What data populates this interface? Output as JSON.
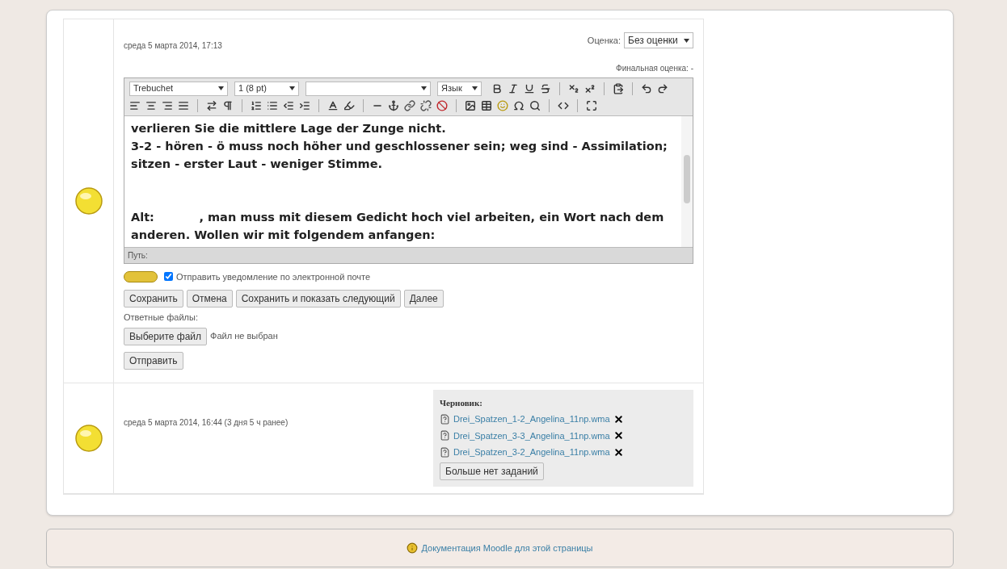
{
  "submissions": [
    {
      "kind": "editing",
      "date": "среда 5 марта 2014, 17:13",
      "grade_label": "Оценка:",
      "grade_value": "Без оценки",
      "final_grade": "Финальная оценка: -",
      "editor": {
        "font": "Trebuchet",
        "size": "1 (8 pt)",
        "language": "Язык",
        "paragraphs": [
          "verlieren Sie die mittlere Lage der Zunge nicht.\n3-2 - hören - ö muss noch höher und geschlossener sein; weg sind - Assimilation; sitzen - erster Laut - weniger Stimme.",
          "Alt:           , man muss mit diesem Gedicht hoch viel arbeiten, ein Wort nach dem anderen. Wollen wir mit folgendem anfangen:"
        ],
        "path_label": "Путь:"
      },
      "notify": {
        "label": "Отправить уведомление по электронной почте",
        "checked": true
      },
      "buttons": [
        "Сохранить",
        "Отмена",
        "Сохранить и показать следующий",
        "Далее"
      ],
      "files_label": "Ответные файлы:",
      "choose_button": "Выберите файл",
      "no_file": "Файл не выбран",
      "send_button": "Отправить"
    },
    {
      "kind": "draft",
      "date": "среда 5 марта 2014, 16:44 (3 дня 5 ч ранее)",
      "drafts_title": "Черновик:",
      "files": [
        "Drei_Spatzen_1-2_Angelina_11np.wma",
        "Drei_Spatzen_3-3_Angelina_11np.wma",
        "Drei_Spatzen_3-2_Angelina_11np.wma"
      ],
      "more_button": "Больше нет заданий"
    }
  ],
  "footer_link": "Документация Moodle для этой страницы"
}
